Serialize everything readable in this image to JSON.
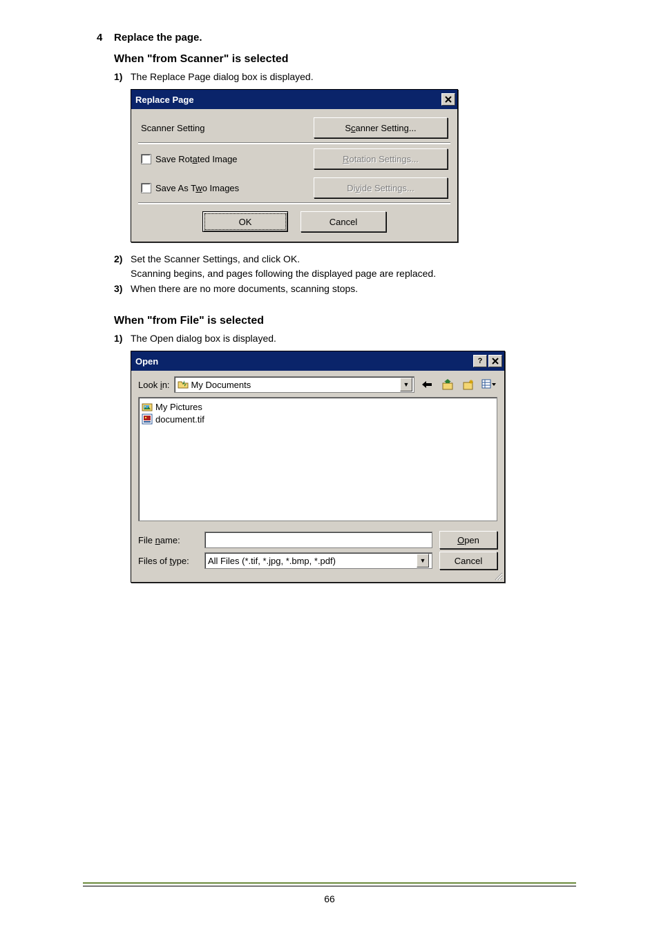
{
  "step": {
    "num": "4",
    "text": "Replace the page."
  },
  "scannerSection": {
    "heading": "When \"from Scanner\" is selected",
    "item1": {
      "num": "1)",
      "text": "The Replace Page dialog box is displayed."
    },
    "item2": {
      "num": "2)",
      "line1": "Set the Scanner Settings, and click OK.",
      "line2": "Scanning begins, and pages following the displayed page are replaced."
    },
    "item3": {
      "num": "3)",
      "text": "When there are no more documents, scanning stops."
    }
  },
  "dlg1": {
    "title": "Replace Page",
    "scannerSettingLabel": "Scanner Setting",
    "scannerSettingBtnPre": "S",
    "scannerSettingBtnU": "c",
    "scannerSettingBtnPost": "anner Setting...",
    "saveRotatedPre": "Save Rot",
    "saveRotatedU": "a",
    "saveRotatedPost": "ted Image",
    "rotationBtnPre": "",
    "rotationBtnU": "R",
    "rotationBtnPost": "otation Settings...",
    "saveTwoPre": "Save As T",
    "saveTwoU": "w",
    "saveTwoPost": "o Images",
    "divideBtnPre": "Di",
    "divideBtnU": "v",
    "divideBtnPost": "ide Settings...",
    "ok": "OK",
    "cancel": "Cancel"
  },
  "fileSection": {
    "heading": "When \"from File\" is selected",
    "item1": {
      "num": "1)",
      "text": "The Open dialog box is displayed."
    }
  },
  "dlg2": {
    "title": "Open",
    "lookInPre": "Look ",
    "lookInU": "i",
    "lookInPost": "n:",
    "lookInValue": "My Documents",
    "files": {
      "f1": "My Pictures",
      "f2": "document.tif"
    },
    "fileNamePre": "File ",
    "fileNameU": "n",
    "fileNamePost": "ame:",
    "fileNameValue": "",
    "filesTypePre": "Files of ",
    "filesTypeU": "t",
    "filesTypePost": "ype:",
    "filesTypeValue": "All Files (*.tif, *.jpg, *.bmp, *.pdf)",
    "openPre": "",
    "openU": "O",
    "openPost": "pen",
    "cancel": "Cancel"
  },
  "pageNumber": "66"
}
